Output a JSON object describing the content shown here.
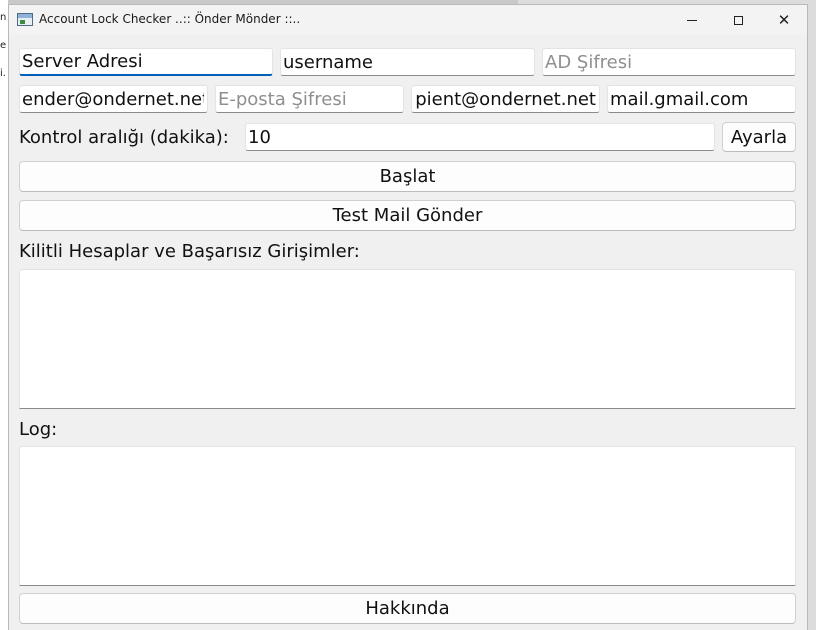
{
  "window": {
    "title": "Account Lock Checker ..:: Önder Mönder ::.."
  },
  "server": {
    "server_value": "Server Adresi",
    "username_value": "username",
    "ad_password_placeholder": "AD Şifresi"
  },
  "email": {
    "sender_value": "ender@ondernet.net",
    "email_password_placeholder": "E-posta Şifresi",
    "recipient_value": "pient@ondernet.net",
    "smtp_value": "mail.gmail.com"
  },
  "interval": {
    "label": "Kontrol aralığı (dakika):",
    "value": "10",
    "set_button": "Ayarla"
  },
  "actions": {
    "start_button": "Başlat",
    "test_mail_button": "Test Mail Gönder",
    "about_button": "Hakkında"
  },
  "locked": {
    "label": "Kilitli Hesaplar ve Başarısız Girişimler:"
  },
  "log": {
    "label": "Log:"
  }
}
